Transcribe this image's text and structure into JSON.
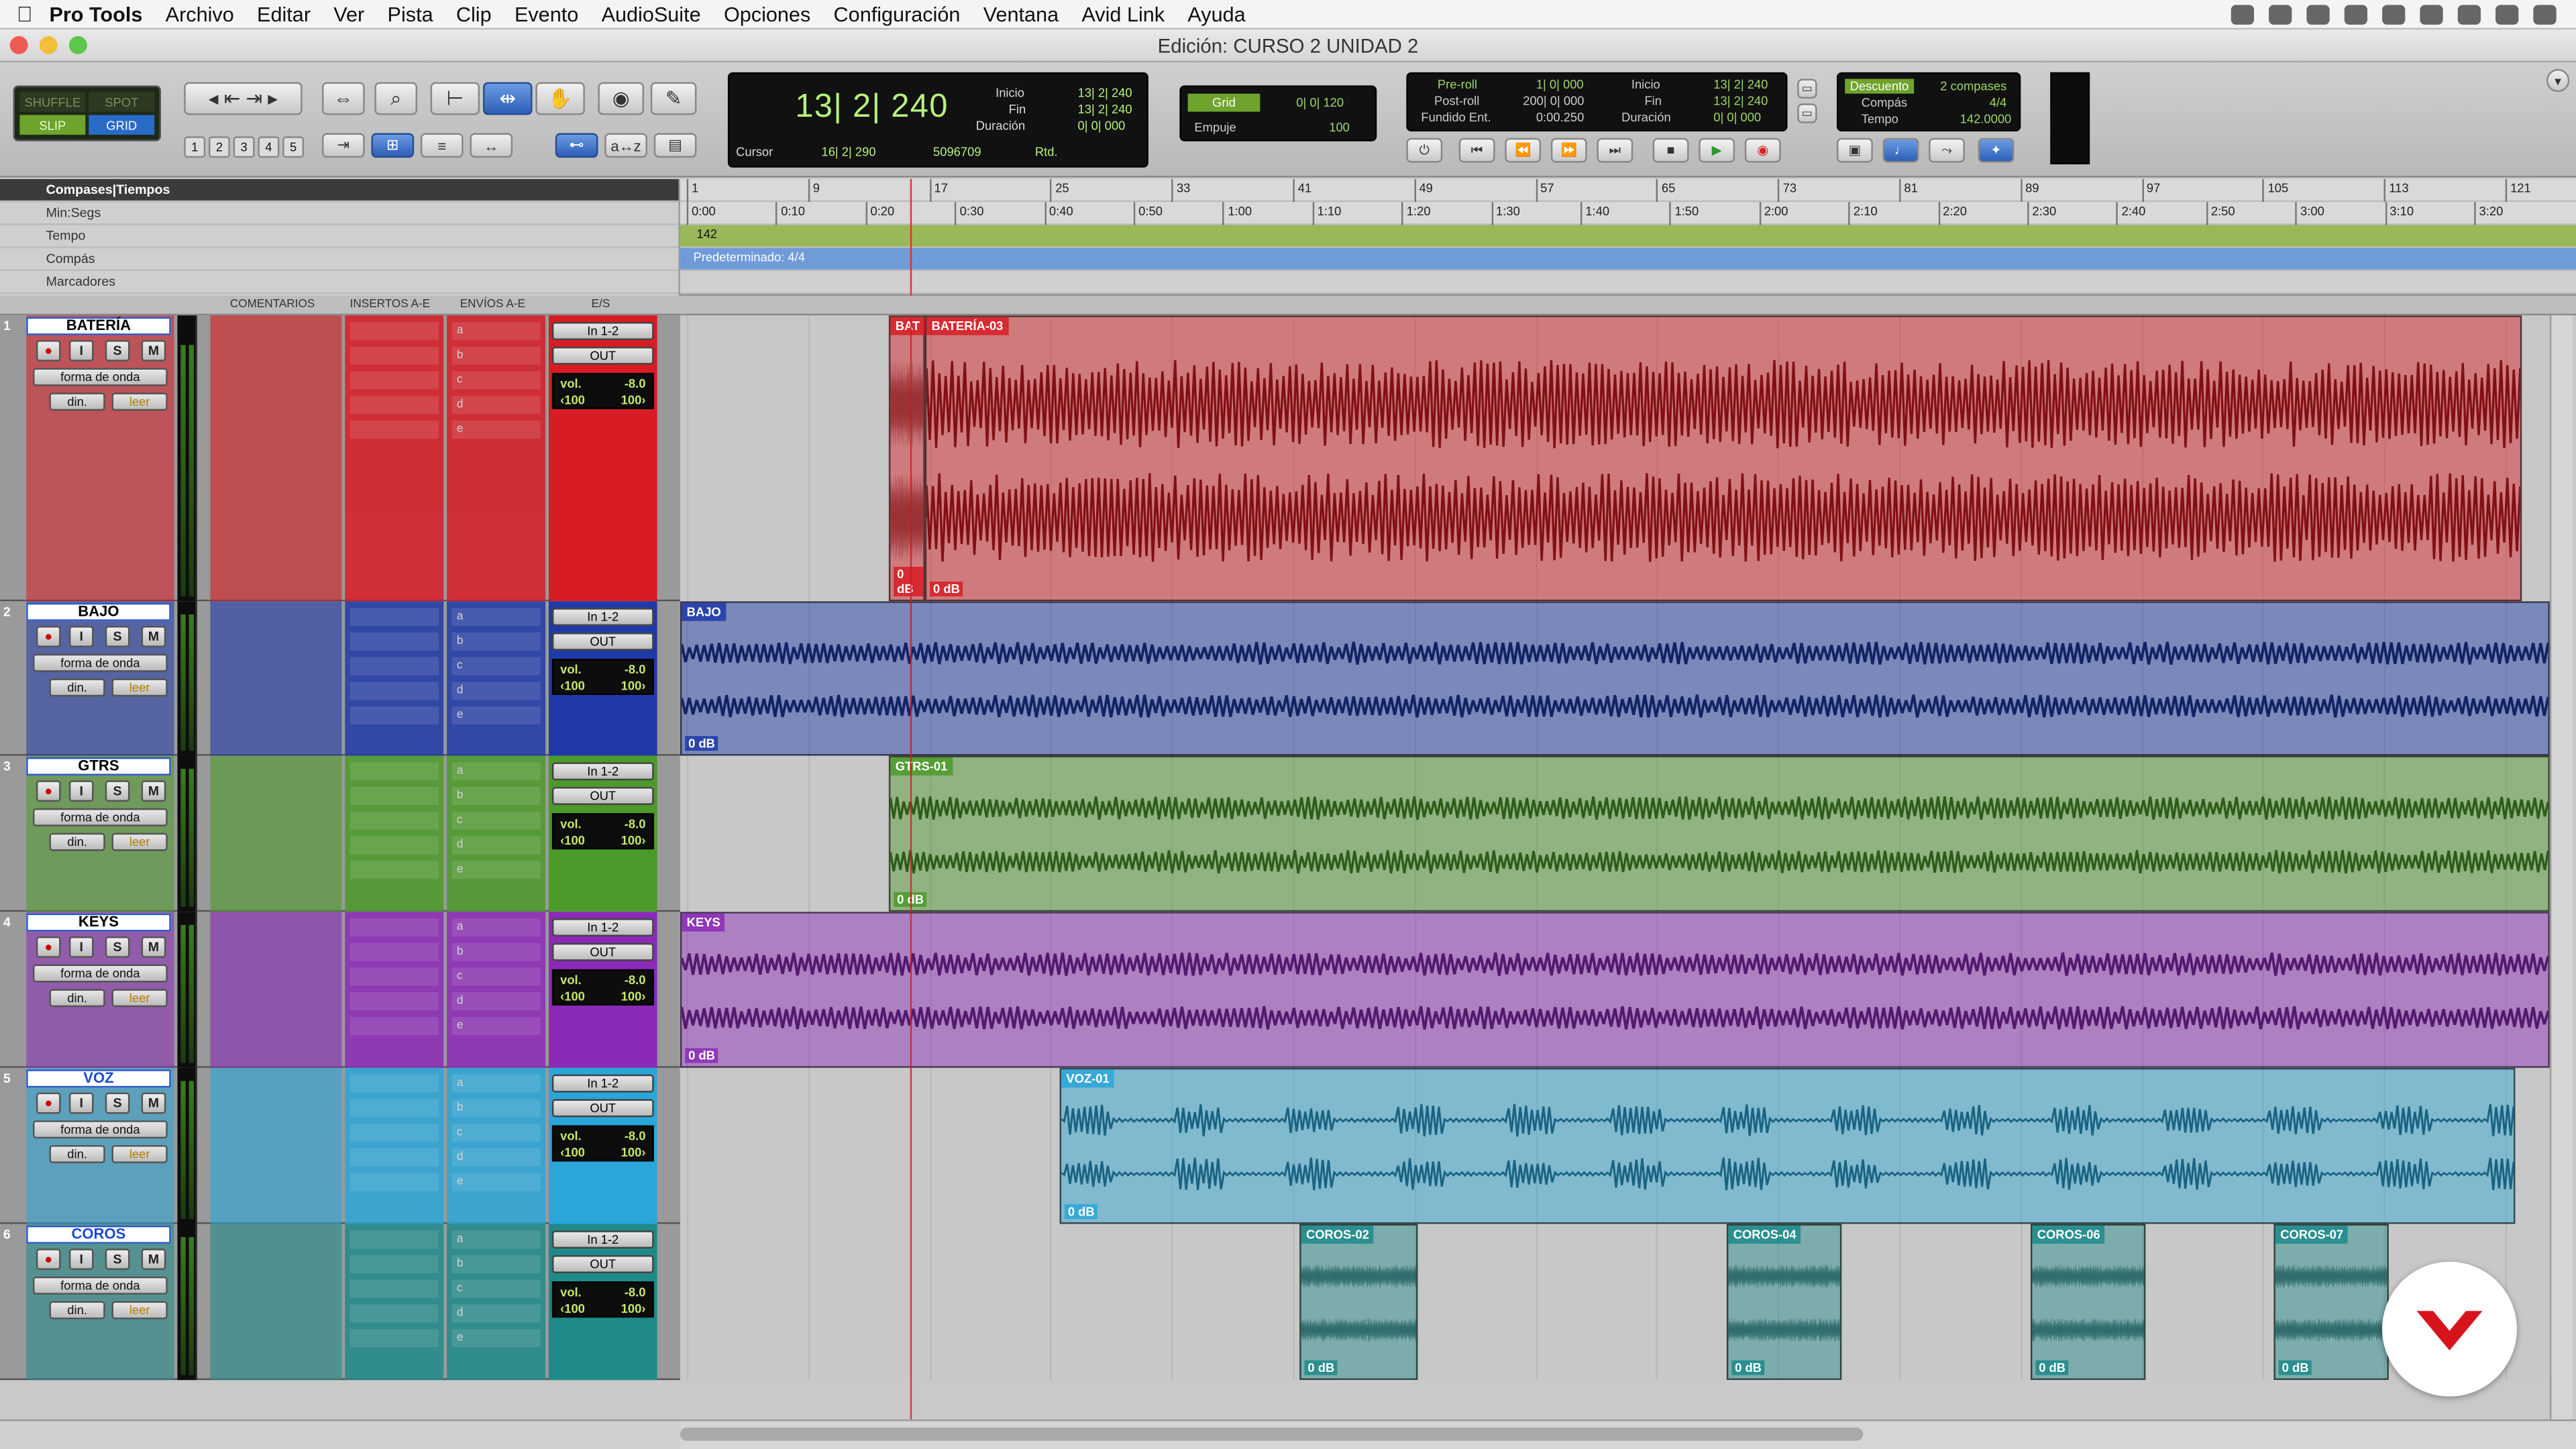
{
  "menubar": {
    "app": "Pro Tools",
    "items": [
      "Archivo",
      "Editar",
      "Ver",
      "Pista",
      "Clip",
      "Evento",
      "AudioSuite",
      "Opciones",
      "Configuración",
      "Ventana",
      "Avid Link",
      "Ayuda"
    ]
  },
  "window": {
    "title": "Edición: CURSO 2 UNIDAD 2"
  },
  "edit_modes": {
    "shuffle": "SHUFFLE",
    "spot": "SPOT",
    "slip": "SLIP",
    "grid": "GRID"
  },
  "zoom_presets": [
    "1",
    "2",
    "3",
    "4",
    "5"
  ],
  "counter": {
    "main": "13| 2| 240",
    "inicio_label": "Inicio",
    "inicio": "13| 2| 240",
    "fin_label": "Fin",
    "fin": "13| 2| 240",
    "duracion_label": "Duración",
    "duracion": "0| 0| 000",
    "cursor_label": "Cursor",
    "cursor": "16| 2| 290",
    "sample": "5096709",
    "rtd": "Rtd."
  },
  "grid": {
    "label": "Grid",
    "value": "0| 0| 120",
    "empuje_label": "Empuje",
    "empuje": "100"
  },
  "transport_display": {
    "preroll_label": "Pre-roll",
    "preroll": "1| 0| 000",
    "postroll_label": "Post-roll",
    "postroll": "200| 0| 000",
    "fundido_label": "Fundido Ent.",
    "fundido": "0:00.250",
    "inicio_label": "Inicio",
    "inicio": "13| 2| 240",
    "fin_label": "Fin",
    "fin": "13| 2| 240",
    "duracion_label": "Duración",
    "duracion": "0| 0| 000"
  },
  "count_off": {
    "label": "Descuento",
    "value": "2 compases",
    "compas_label": "Compás",
    "compas": "4/4",
    "tempo_label": "Tempo",
    "tempo": "142.0000"
  },
  "rulers": {
    "labels": [
      "Compases|Tiempos",
      "Min:Segs",
      "Tempo",
      "Compás",
      "Marcadores"
    ],
    "bars": [
      "1",
      "9",
      "17",
      "25",
      "33",
      "41",
      "49",
      "57",
      "65",
      "73",
      "81",
      "89",
      "97",
      "105",
      "113",
      "121"
    ],
    "times": [
      "0:00",
      "0:10",
      "0:20",
      "0:30",
      "0:40",
      "0:50",
      "1:00",
      "1:10",
      "1:20",
      "1:30",
      "1:40",
      "1:50",
      "2:00",
      "2:10",
      "2:20",
      "2:30",
      "2:40",
      "2:50",
      "3:00",
      "3:10",
      "3:20"
    ],
    "tempo_value": "142",
    "meter_value": "Predeterminado: 4/4"
  },
  "columns": {
    "comentarios": "COMENTARIOS",
    "inserts": "INSERTOS A-E",
    "sends": "ENVÍOS A-E",
    "io": "E/S"
  },
  "track_common": {
    "rec": "●",
    "input": "I",
    "solo": "S",
    "mute": "M",
    "view": "forma de onda",
    "dyn": "din.",
    "auto": "leer",
    "in": "In 1-2",
    "out": "OUT",
    "vol_label": "vol.",
    "vol": "-8.0",
    "pan_l": "‹100",
    "pan_r": "100›",
    "sends": [
      "a",
      "b",
      "c",
      "d",
      "e"
    ]
  },
  "tracks": [
    {
      "num": "1",
      "name": "BATERÍA",
      "color": "#d81c24",
      "clips": [
        "BAT",
        "BATERÍA-03"
      ],
      "gain": "0 dB"
    },
    {
      "num": "2",
      "name": "BAJO",
      "color": "#1f3aa8",
      "clips": [
        "BAJO"
      ],
      "gain": "0 dB"
    },
    {
      "num": "3",
      "name": "GTRS",
      "color": "#4c9a2a",
      "clips": [
        "GTRS-01"
      ],
      "gain": "0 dB"
    },
    {
      "num": "4",
      "name": "KEYS",
      "color": "#8b2ab8",
      "clips": [
        "KEYS"
      ],
      "gain": "0 dB"
    },
    {
      "num": "5",
      "name": "VOZ",
      "color": "#2aa6d8",
      "clips": [
        "VOZ-01"
      ],
      "gain": "0 dB"
    },
    {
      "num": "6",
      "name": "COROS",
      "color": "#1f8a8a",
      "clips": [
        "COROS-02",
        "COROS-04",
        "COROS-06",
        "COROS-07"
      ],
      "gain": "0 dB"
    }
  ]
}
